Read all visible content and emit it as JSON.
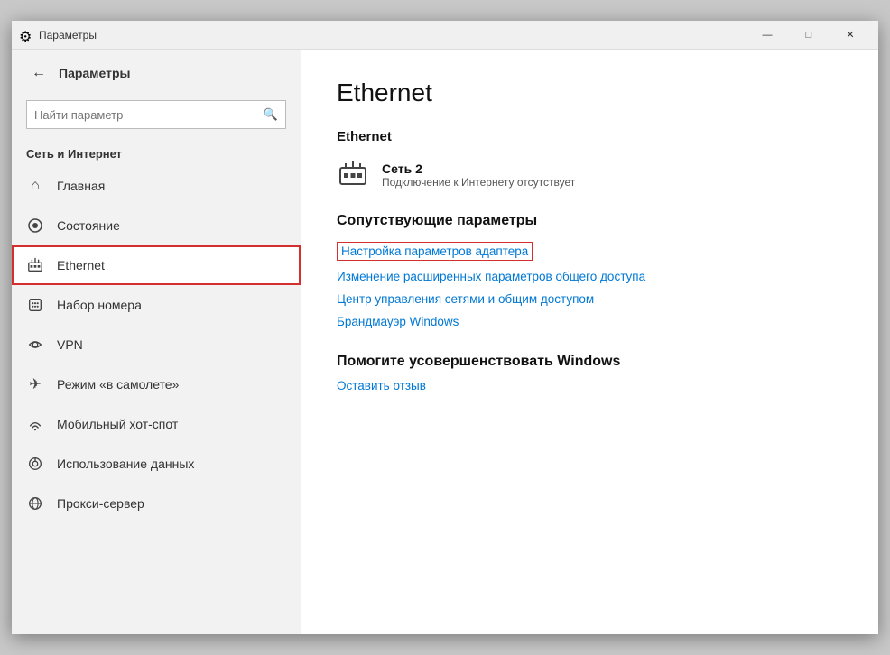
{
  "window": {
    "title": "Параметры",
    "controls": {
      "minimize": "—",
      "maximize": "□",
      "close": "✕"
    }
  },
  "sidebar": {
    "back_label": "←",
    "title": "Параметры",
    "search_placeholder": "Найти параметр",
    "section_header": "Сеть и Интернет",
    "nav_items": [
      {
        "id": "home",
        "icon": "⌂",
        "label": "Главная"
      },
      {
        "id": "status",
        "icon": "◎",
        "label": "Состояние"
      },
      {
        "id": "ethernet",
        "icon": "🖥",
        "label": "Ethernet",
        "active": true
      },
      {
        "id": "dialup",
        "icon": "☎",
        "label": "Набор номера"
      },
      {
        "id": "vpn",
        "icon": "✦",
        "label": "VPN"
      },
      {
        "id": "airplane",
        "icon": "✈",
        "label": "Режим «в самолете»"
      },
      {
        "id": "hotspot",
        "icon": "📶",
        "label": "Мобильный хот-спот"
      },
      {
        "id": "data",
        "icon": "◉",
        "label": "Использование данных"
      },
      {
        "id": "proxy",
        "icon": "🌐",
        "label": "Прокси-сервер"
      }
    ]
  },
  "main": {
    "title": "Ethernet",
    "section_ethernet": "Ethernet",
    "network_name": "Сеть 2",
    "network_status": "Подключение к Интернету отсутствует",
    "related_section": "Сопутствующие параметры",
    "links": [
      {
        "id": "adapter",
        "text": "Настройка параметров адаптера",
        "highlighted": true
      },
      {
        "id": "sharing",
        "text": "Изменение расширенных параметров общего доступа"
      },
      {
        "id": "network-center",
        "text": "Центр управления сетями и общим доступом"
      },
      {
        "id": "firewall",
        "text": "Брандмауэр Windows"
      }
    ],
    "improve_section": "Помогите усовершенствовать Windows",
    "feedback_link": "Оставить отзыв"
  }
}
